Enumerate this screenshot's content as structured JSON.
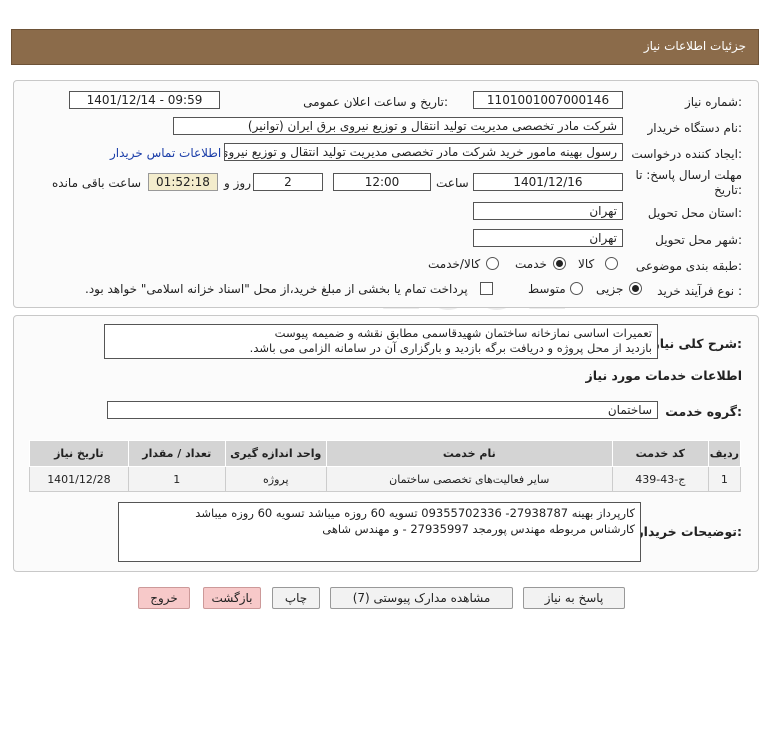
{
  "header": {
    "title": "جزئیات اطلاعات نیاز"
  },
  "form": {
    "need_number_label": "شماره نیاز:",
    "need_number": "1101001007000146",
    "announce_label": "تاریخ و ساعت اعلان عمومی:",
    "announce_value": "1401/12/14 - 09:59",
    "buyer_label": "نام دستگاه خریدار:",
    "buyer_value": "شرکت مادر تخصصی مدیریت تولید  انتقال و توزیع نیروی برق ایران (توانیر)",
    "creator_label": "ایجاد کننده درخواست:",
    "creator_value": "رسول بهینه مامور خرید شرکت مادر تخصصی مدیریت تولید  انتقال و توزیع نیروی برق",
    "contact_link": "اطلاعات تماس خریدار",
    "deadline_label_1": "مهلت ارسال پاسخ: تا",
    "deadline_label_2": "تاریخ:",
    "deadline_date": "1401/12/16",
    "time_label": "ساعت",
    "deadline_time": "12:00",
    "days_value": "2",
    "days_label": "روز و",
    "remaining_time": "01:52:18",
    "remaining_label": "ساعت باقی مانده",
    "province_label": "استان محل تحویل:",
    "province_value": "تهران",
    "city_label": "شهر محل تحویل:",
    "city_value": "تهران",
    "category_label": "طبقه بندی موضوعی:",
    "category_options": [
      "کالا",
      "خدمت",
      "کالا/خدمت"
    ],
    "category_selected": "خدمت",
    "process_label": "نوع فرآیند خرید :",
    "process_options": [
      "جزیی",
      "متوسط"
    ],
    "process_selected": "جزیی",
    "payment_text": "پرداخت تمام یا بخشی از مبلغ خرید،از محل \"اسناد خزانه اسلامی\" خواهد بود."
  },
  "description": {
    "label": "شرح کلی نیاز:",
    "line1": "تعمیرات اساسی نمازخانه ساختمان شهیدقاسمی مطابق نقشه و ضمیمه پیوست",
    "line2": "بازدید از محل پروژه و دریافت برگه بازدید و بارگزاری آن در سامانه الزامی می باشد."
  },
  "services": {
    "section_title": "اطلاعات خدمات مورد نیاز",
    "group_label": "گروه خدمت:",
    "group_value": "ساختمان",
    "columns": [
      "ردیف",
      "کد خدمت",
      "نام خدمت",
      "واحد اندازه گیری",
      "تعداد / مقدار",
      "تاریخ نیاز"
    ],
    "rows": [
      [
        "1",
        "ج-43-439",
        "سایر فعالیت‌های تخصصی ساختمان",
        "پروژه",
        "1",
        "1401/12/28"
      ]
    ]
  },
  "notes": {
    "label": "توضیحات خریدار:",
    "line1": "کارپرداز بهینه 27938787- 09355702336          تسویه 60 روزه میباشد تسویه 60 روزه میباشد",
    "line2": "کارشناس مربوطه مهندس پورمجد 27935997 - و مهندس شاهی"
  },
  "buttons": {
    "reply": "پاسخ به نیاز",
    "attachments": "مشاهده مدارک پیوستی (7)",
    "print": "چاپ",
    "back": "بازگشت",
    "exit": "خروج"
  }
}
